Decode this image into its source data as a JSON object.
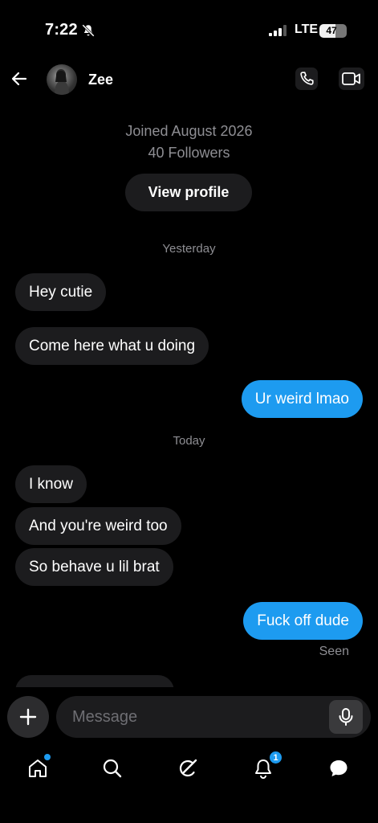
{
  "status_bar": {
    "time": "7:22",
    "network": "LTE",
    "battery": "47"
  },
  "header": {
    "contact_name": "Zee",
    "icons": [
      "back-arrow-icon",
      "phone-icon",
      "video-camera-icon"
    ]
  },
  "profile": {
    "joined": "Joined August 2026",
    "followers": "40 Followers",
    "view_profile_label": "View profile"
  },
  "conversation": {
    "date_yesterday": "Yesterday",
    "date_today": "Today",
    "messages": [
      {
        "direction": "incoming",
        "text": "Hey cutie"
      },
      {
        "direction": "incoming",
        "text": "Come here what u doing"
      },
      {
        "direction": "outgoing",
        "text": "Ur weird lmao"
      },
      {
        "direction": "incoming",
        "text": "I know"
      },
      {
        "direction": "incoming",
        "text": "And you're weird too"
      },
      {
        "direction": "incoming",
        "text": "So behave u lil brat"
      },
      {
        "direction": "outgoing",
        "text": "Fuck off dude"
      }
    ],
    "seen_label": "Seen"
  },
  "composer": {
    "placeholder": "Message"
  },
  "tab_bar": {
    "tabs": [
      "home-icon",
      "search-icon",
      "grok-icon",
      "bell-icon",
      "messages-icon"
    ],
    "notification_count": "1"
  },
  "colors": {
    "accent": "#1d9bf0",
    "incoming_bubble": "#1c1c1e",
    "background": "#000000",
    "secondary_text": "#8e8e93"
  }
}
